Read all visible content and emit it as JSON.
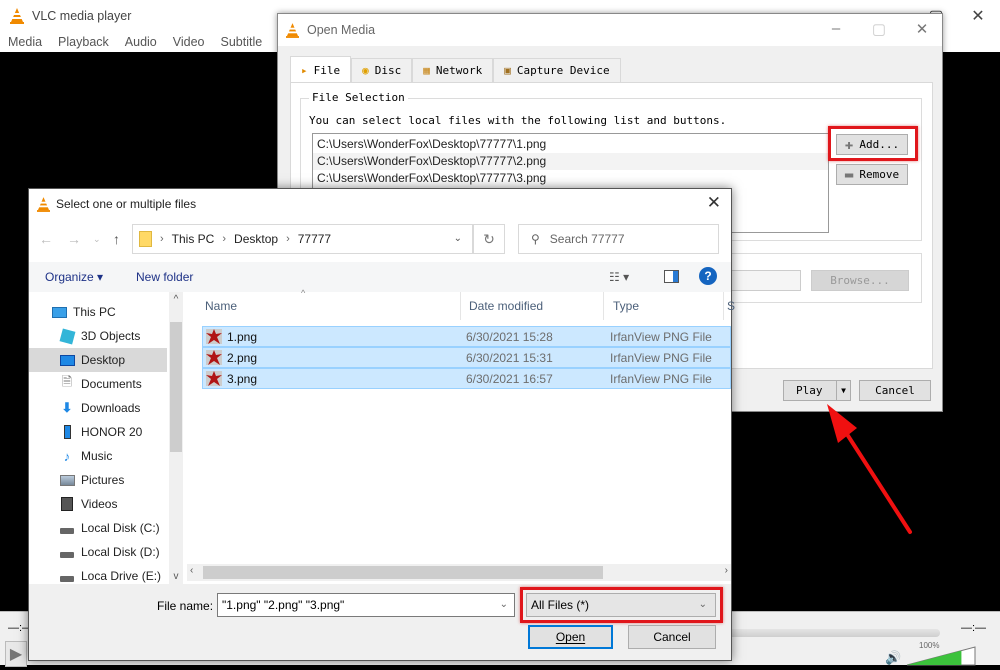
{
  "vlc": {
    "title": "VLC media player",
    "menu": [
      "Media",
      "Playback",
      "Audio",
      "Video",
      "Subtitle",
      "T"
    ],
    "time_left": "—:—",
    "time_right": "—:—",
    "volume_label": "100%",
    "volume_level": 1.0
  },
  "open_media": {
    "title": "Open Media",
    "tabs": [
      {
        "label": "File",
        "icon": "file-icon",
        "active": true
      },
      {
        "label": "Disc",
        "icon": "disc-icon",
        "active": false
      },
      {
        "label": "Network",
        "icon": "network-icon",
        "active": false
      },
      {
        "label": "Capture Device",
        "icon": "capture-device-icon",
        "active": false
      }
    ],
    "file_selection_legend": "File Selection",
    "file_selection_desc": "You can select local files with the following list and buttons.",
    "files": [
      "C:\\Users\\WonderFox\\Desktop\\77777\\1.png",
      "C:\\Users\\WonderFox\\Desktop\\77777\\2.png",
      "C:\\Users\\WonderFox\\Desktop\\77777\\3.png"
    ],
    "add_label": "Add...",
    "remove_label": "Remove",
    "browse_label": "Browse...",
    "play_label": "Play",
    "cancel_label": "Cancel"
  },
  "chooser": {
    "title": "Select one or multiple files",
    "breadcrumb": [
      "This PC",
      "Desktop",
      "77777"
    ],
    "search_placeholder": "Search 77777",
    "organize_label": "Organize ▾",
    "new_folder_label": "New folder",
    "tree": [
      {
        "label": "This PC",
        "icon": "computer-icon",
        "selected": false
      },
      {
        "label": "3D Objects",
        "icon": "3d-objects-icon",
        "selected": false
      },
      {
        "label": "Desktop",
        "icon": "desktop-icon",
        "selected": true
      },
      {
        "label": "Documents",
        "icon": "documents-icon",
        "selected": false
      },
      {
        "label": "Downloads",
        "icon": "downloads-icon",
        "selected": false
      },
      {
        "label": "HONOR 20",
        "icon": "phone-icon",
        "selected": false
      },
      {
        "label": "Music",
        "icon": "music-icon",
        "selected": false
      },
      {
        "label": "Pictures",
        "icon": "pictures-icon",
        "selected": false
      },
      {
        "label": "Videos",
        "icon": "videos-icon",
        "selected": false
      },
      {
        "label": "Local Disk (C:)",
        "icon": "drive-icon",
        "selected": false
      },
      {
        "label": "Local Disk (D:)",
        "icon": "drive-icon",
        "selected": false
      },
      {
        "label": "Loca Drive (E:)",
        "icon": "drive-icon",
        "selected": false
      }
    ],
    "columns": [
      "Name",
      "Date modified",
      "Type",
      "S"
    ],
    "rows": [
      {
        "name": "1.png",
        "date": "6/30/2021 15:28",
        "type": "IrfanView PNG File"
      },
      {
        "name": "2.png",
        "date": "6/30/2021 15:31",
        "type": "IrfanView PNG File"
      },
      {
        "name": "3.png",
        "date": "6/30/2021 16:57",
        "type": "IrfanView PNG File"
      }
    ],
    "file_name_label": "File name:",
    "file_name_value": "\"1.png\" \"2.png\" \"3.png\"",
    "filter_value": "All Files (*)",
    "open_label": "Open",
    "cancel_label": "Cancel"
  },
  "colors": {
    "highlight_red": "#e0161b",
    "selection_blue": "#cce8ff",
    "accent_blue": "#0078d7"
  }
}
